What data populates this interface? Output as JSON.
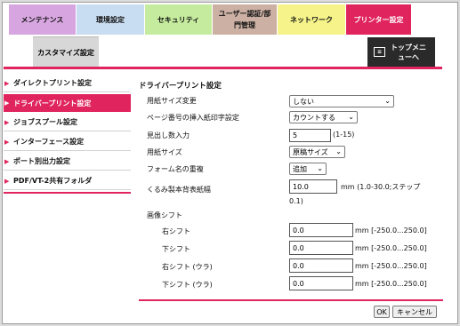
{
  "tabs": [
    {
      "label": "メンテナンス",
      "color": "#d7a6e0"
    },
    {
      "label": "環境設定",
      "color": "#c9ddf2"
    },
    {
      "label": "セキュリティ",
      "color": "#c5ec9e"
    },
    {
      "label": "ユーザー認証/部門管理",
      "color": "#ccb0a4"
    },
    {
      "label": "ネットワーク",
      "color": "#f5f38a"
    },
    {
      "label": "プリンター設定",
      "color": "#e0245e"
    }
  ],
  "tab_customize": "カスタマイズ設定",
  "top_menu": {
    "icon": "top-menu-icon",
    "label": "トップメニューへ"
  },
  "sidebar": {
    "items": [
      {
        "label": "ダイレクトプリント設定"
      },
      {
        "label": "ドライバープリント設定",
        "active": true
      },
      {
        "label": "ジョブスプール設定"
      },
      {
        "label": "インターフェース設定"
      },
      {
        "label": "ポート別出力設定"
      },
      {
        "label": "PDF/VT-2共有フォルダ"
      }
    ]
  },
  "page_title": "ドライバープリント設定",
  "fields": {
    "paper_size_change": {
      "label": "用紙サイズ変更",
      "value": "しない"
    },
    "page_number": {
      "label": "ページ番号の挿入紙印字設定",
      "value": "カウントする"
    },
    "index_count": {
      "label": "見出し数入力",
      "value": "5",
      "unit": "(1-15)"
    },
    "paper_size": {
      "label": "用紙サイズ",
      "value": "原稿サイズ"
    },
    "form_overlap": {
      "label": "フォーム名の重複",
      "value": "追加"
    },
    "spine_width": {
      "label": "くるみ製本背表紙幅",
      "value": "10.0",
      "unit": "mm (1.0-30.0;ステップ",
      "unit2": "0.1)"
    }
  },
  "image_shift": {
    "label": "画像シフト",
    "rows": [
      {
        "label": "右シフト",
        "value": "0.0",
        "unit": "mm [-250.0...250.0]"
      },
      {
        "label": "下シフト",
        "value": "0.0",
        "unit": "mm [-250.0...250.0]"
      },
      {
        "label": "右シフト (ウラ)",
        "value": "0.0",
        "unit": "mm [-250.0...250.0]"
      },
      {
        "label": "下シフト (ウラ)",
        "value": "0.0",
        "unit": "mm [-250.0...250.0]"
      }
    ]
  },
  "buttons": {
    "ok": "OK",
    "cancel": "キャンセル"
  },
  "icons": {
    "arrow": "sidebar-arrow-icon",
    "dropdown": "chevron-down-icon"
  },
  "colors": {
    "accent": "#e0245e"
  }
}
